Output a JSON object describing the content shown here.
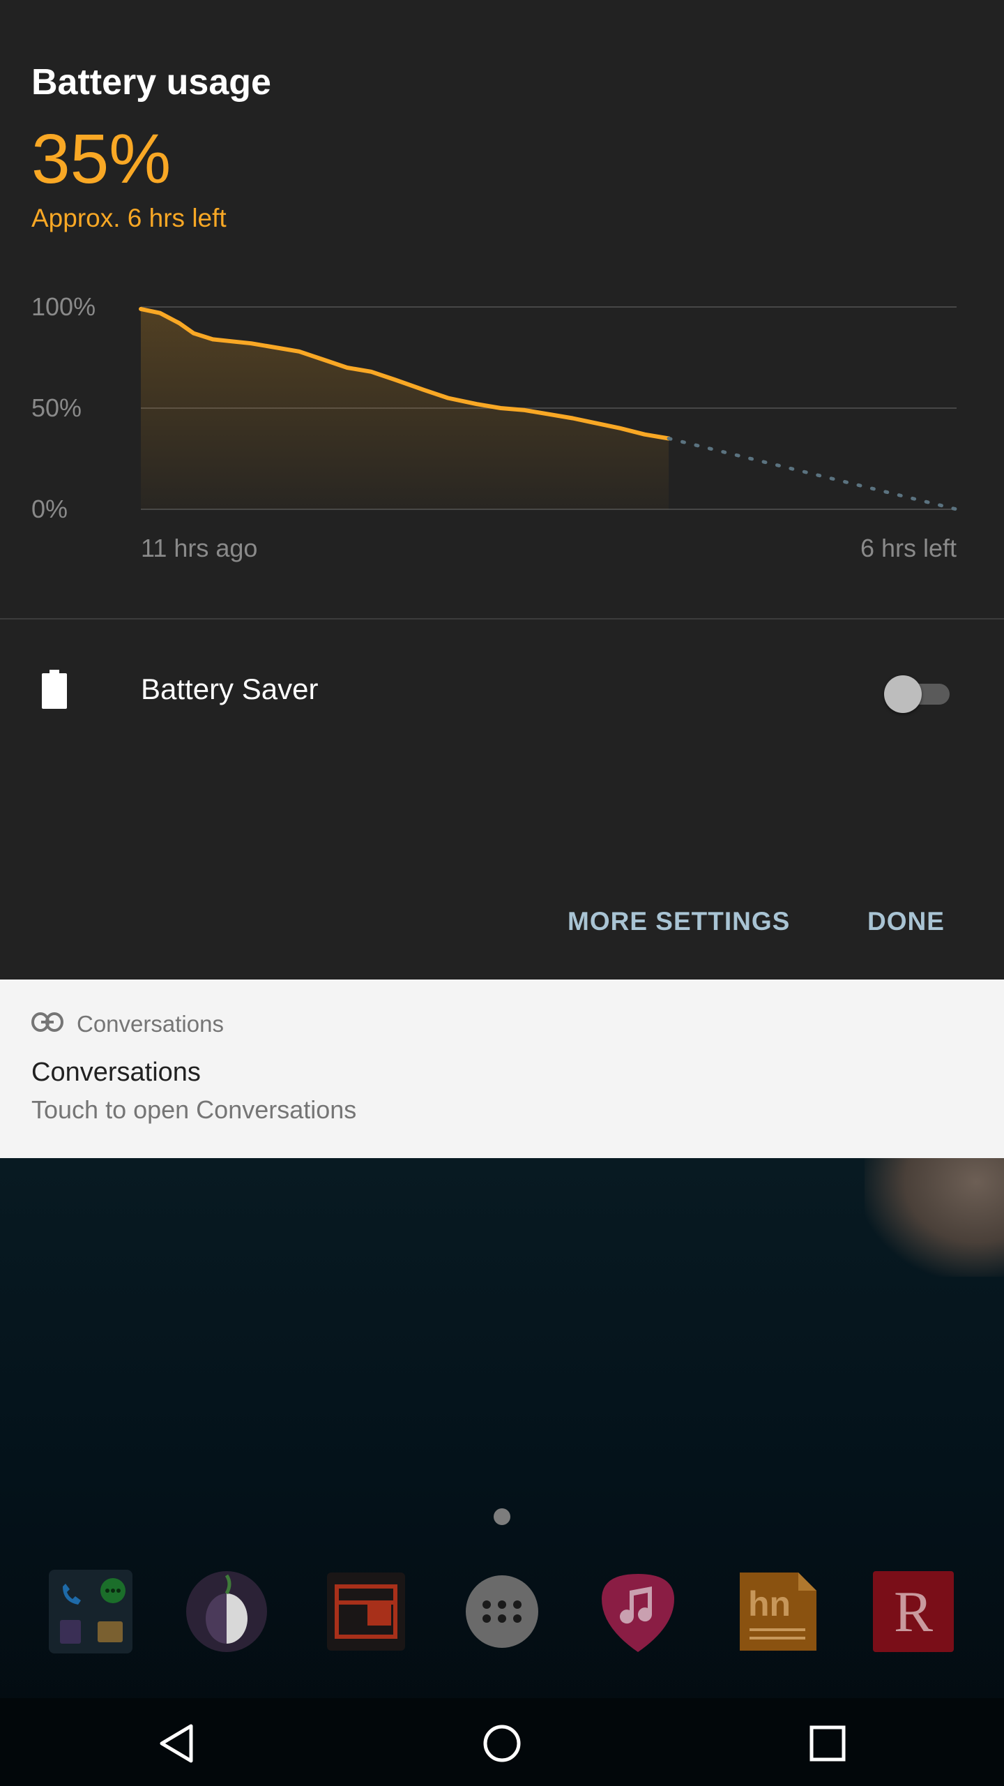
{
  "battery": {
    "title": "Battery usage",
    "percent": "35%",
    "estimate": "Approx. 6 hrs left"
  },
  "chart_data": {
    "type": "line",
    "y_tick_labels": [
      "100%",
      "50%",
      "0%"
    ],
    "x_labels": [
      "11 hrs ago",
      "6 hrs left"
    ],
    "ylim": [
      0,
      100
    ],
    "x_range": [
      -11,
      6
    ],
    "grid": true,
    "series": [
      {
        "x": [
          -11,
          -10.6,
          -10.2,
          -9.9,
          -9.5,
          -9.1,
          -8.7,
          -8.2,
          -7.7,
          -7.2,
          -6.7,
          -6.2,
          -5.7,
          -5.1,
          -4.6,
          -4.0,
          -3.5,
          -3,
          -2.5,
          -2.0,
          -1.6,
          -1.0,
          -0.5,
          0
        ],
        "y": [
          99,
          97,
          92,
          87,
          84,
          83,
          82,
          80,
          78,
          74,
          70,
          68,
          64,
          59,
          55,
          52,
          50,
          49,
          47,
          45,
          43,
          40,
          37,
          35
        ]
      },
      {
        "x": [
          0,
          6
        ],
        "y": [
          35,
          0
        ]
      }
    ]
  },
  "saver": {
    "label": "Battery Saver",
    "enabled": false
  },
  "actions": {
    "more_settings": "MORE SETTINGS",
    "done": "DONE"
  },
  "notification": {
    "app_name": "Conversations",
    "title": "Conversations",
    "text": "Touch to open Conversations"
  },
  "dock": {
    "apps": [
      "phone-messages-folder-icon",
      "tor-onion-icon",
      "news-reader-icon",
      "app-drawer-icon",
      "music-icon",
      "hacker-news-icon",
      "reddit-r-icon"
    ]
  },
  "colors": {
    "accent": "#f9a825",
    "panel": "#222222",
    "button_text": "#a9c4d4"
  }
}
